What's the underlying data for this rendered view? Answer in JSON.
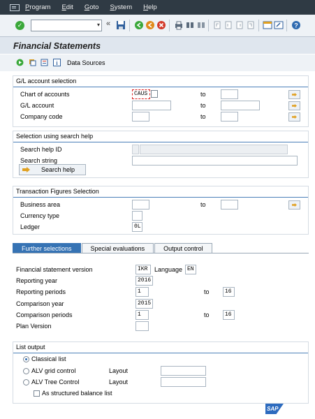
{
  "menu": [
    "Program",
    "Edit",
    "Goto",
    "System",
    "Help"
  ],
  "menu_underline": [
    "P",
    "E",
    "G",
    "S",
    "H"
  ],
  "menu_rest": [
    "rogram",
    "dit",
    "oto",
    "ystem",
    "elp"
  ],
  "title": "Financial Statements",
  "app_toolbar": {
    "data_sources": "Data Sources"
  },
  "gl_selection": {
    "title": "G/L account selection",
    "chart_of_accounts": {
      "label": "Chart of accounts",
      "value": "CAUS"
    },
    "gl_account": {
      "label": "G/L account",
      "value": ""
    },
    "company_code": {
      "label": "Company code",
      "value": ""
    },
    "to": "to"
  },
  "search_help": {
    "title": "Selection using search help",
    "id_label": "Search help ID",
    "string_label": "Search string",
    "button": "Search help"
  },
  "transaction": {
    "title": "Transaction Figures Selection",
    "business_area": "Business area",
    "currency_type": "Currency type",
    "ledger": {
      "label": "Ledger",
      "value": "0L"
    },
    "to": "to"
  },
  "tabs": [
    "Further selections",
    "Special evaluations",
    "Output control"
  ],
  "further": {
    "fsv_label": "Financial statement version",
    "fsv_value": "IKR",
    "language_label": "Language",
    "language_value": "EN",
    "reporting_year_label": "Reporting year",
    "reporting_year": "2016",
    "reporting_periods_label": "Reporting periods",
    "reporting_from": "1",
    "reporting_to": "16",
    "comparison_year_label": "Comparison year",
    "comparison_year": "2015",
    "comparison_periods_label": "Comparison periods",
    "comparison_from": "1",
    "comparison_to": "16",
    "plan_version_label": "Plan Version",
    "to": "to"
  },
  "list_output": {
    "title": "List output",
    "classical": "Classical list",
    "alv_grid": "ALV grid control",
    "alv_tree": "ALV Tree Control",
    "layout": "Layout",
    "structured": "As structured balance list"
  },
  "colors": {
    "menubar": "#2f3a44",
    "tab_active": "#3673b4",
    "group_line": "#4a7fb8"
  }
}
